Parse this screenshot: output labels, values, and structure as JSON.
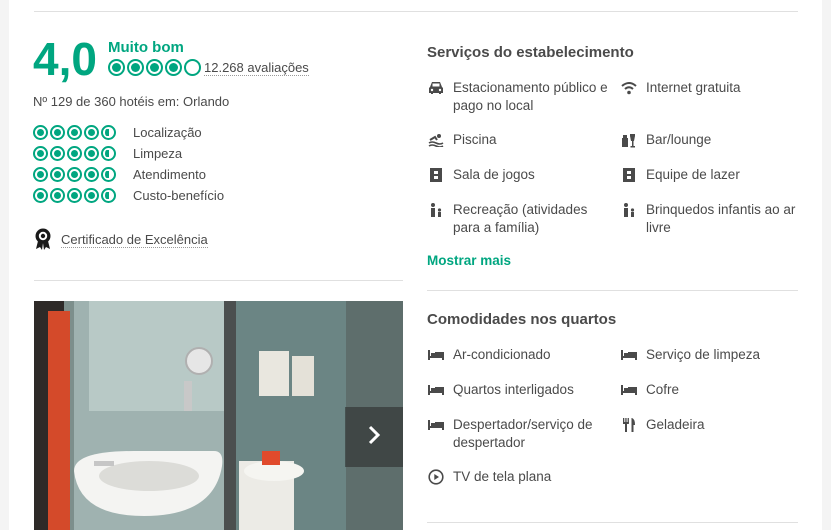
{
  "summary": {
    "score": "4,0",
    "rating_label": "Muito bom",
    "bubble_rating": 4.0,
    "review_count": "12.268 avaliações",
    "ranking": "Nº 129 de 360 hotéis em: Orlando"
  },
  "sub_ratings": [
    {
      "label": "Localização",
      "rating": 4.5
    },
    {
      "label": "Limpeza",
      "rating": 4.5
    },
    {
      "label": "Atendimento",
      "rating": 4.5
    },
    {
      "label": "Custo-benefício",
      "rating": 4.5
    }
  ],
  "certificate": {
    "label": "Certificado de Excelência",
    "icon": "award-badge-icon"
  },
  "photo": {
    "next_icon": "chevron-right-icon"
  },
  "services": {
    "title": "Serviços do estabelecimento",
    "items": [
      {
        "label": "Estacionamento público e pago no local",
        "icon": "car-icon"
      },
      {
        "label": "Internet gratuita",
        "icon": "wifi-icon"
      },
      {
        "label": "Piscina",
        "icon": "pool-icon"
      },
      {
        "label": "Bar/lounge",
        "icon": "bar-icon"
      },
      {
        "label": "Sala de jogos",
        "icon": "game-icon"
      },
      {
        "label": "Equipe de lazer",
        "icon": "game-icon"
      },
      {
        "label": "Recreação (atividades para a família)",
        "icon": "family-icon"
      },
      {
        "label": "Brinquedos infantis ao ar livre",
        "icon": "family-icon"
      }
    ],
    "show_more": "Mostrar mais"
  },
  "rooms": {
    "title": "Comodidades nos quartos",
    "items": [
      {
        "label": "Ar-condicionado",
        "icon": "bed-icon"
      },
      {
        "label": "Serviço de limpeza",
        "icon": "bed-icon"
      },
      {
        "label": "Quartos interligados",
        "icon": "bed-icon"
      },
      {
        "label": "Cofre",
        "icon": "bed-icon"
      },
      {
        "label": "Despertador/serviço de despertador",
        "icon": "bed-icon"
      },
      {
        "label": "Geladeira",
        "icon": "fork-knife-icon"
      },
      {
        "label": "TV de tela plana",
        "icon": "play-icon"
      }
    ]
  },
  "colors": {
    "accent": "#00a680",
    "text": "#4a4a4a",
    "divider": "#e0e0e0"
  }
}
